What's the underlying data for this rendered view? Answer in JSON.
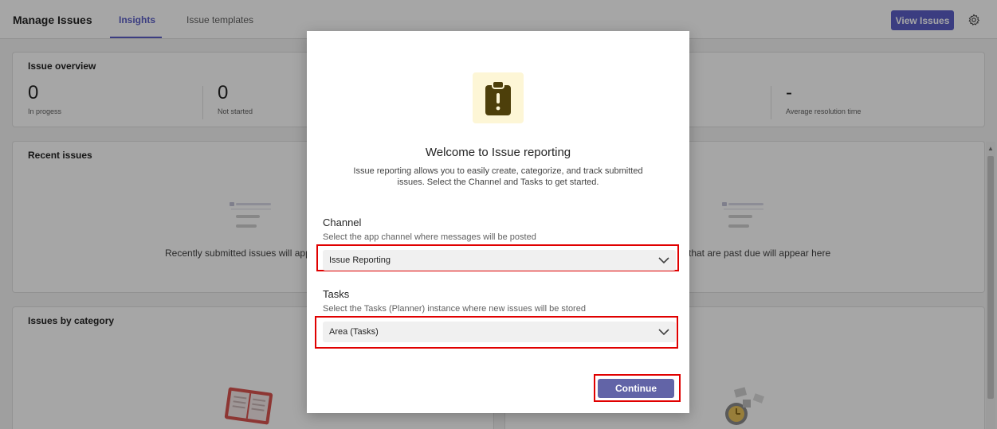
{
  "header": {
    "app_title": "Manage Issues",
    "tabs": [
      {
        "label": "Insights",
        "active": true
      },
      {
        "label": "Issue templates",
        "active": false
      }
    ],
    "view_issues_label": "View Issues",
    "settings_icon": "gear-icon"
  },
  "overview": {
    "title": "Issue overview",
    "metrics": [
      {
        "value": "0",
        "label": "In progess"
      },
      {
        "value": "0",
        "label": "Not started"
      },
      {
        "value": "-",
        "label": "Average resolution time"
      }
    ]
  },
  "recent_issues": {
    "title": "Recent issues",
    "empty_text": "Recently submitted issues will appe"
  },
  "past_due": {
    "empty_text": "that are past due will appear here"
  },
  "category": {
    "title": "Issues by category"
  },
  "dialog": {
    "hero_icon": "clipboard-alert-icon",
    "title": "Welcome to Issue reporting",
    "description": "Issue reporting allows you to easily create, categorize, and track submitted issues. Select the Channel and Tasks to get started.",
    "channel": {
      "label": "Channel",
      "help": "Select the app channel where messages will be posted",
      "value": "Issue Reporting"
    },
    "tasks": {
      "label": "Tasks",
      "help": "Select the Tasks (Planner) instance where new issues will be stored",
      "value": "Area (Tasks)"
    },
    "continue_label": "Continue"
  },
  "colors": {
    "accent": "#5b5fc7",
    "continue_button": "#6264a7",
    "highlight": "#e00000",
    "hero_bg": "#fdf6d6",
    "hero_icon": "#4d3f0a"
  }
}
